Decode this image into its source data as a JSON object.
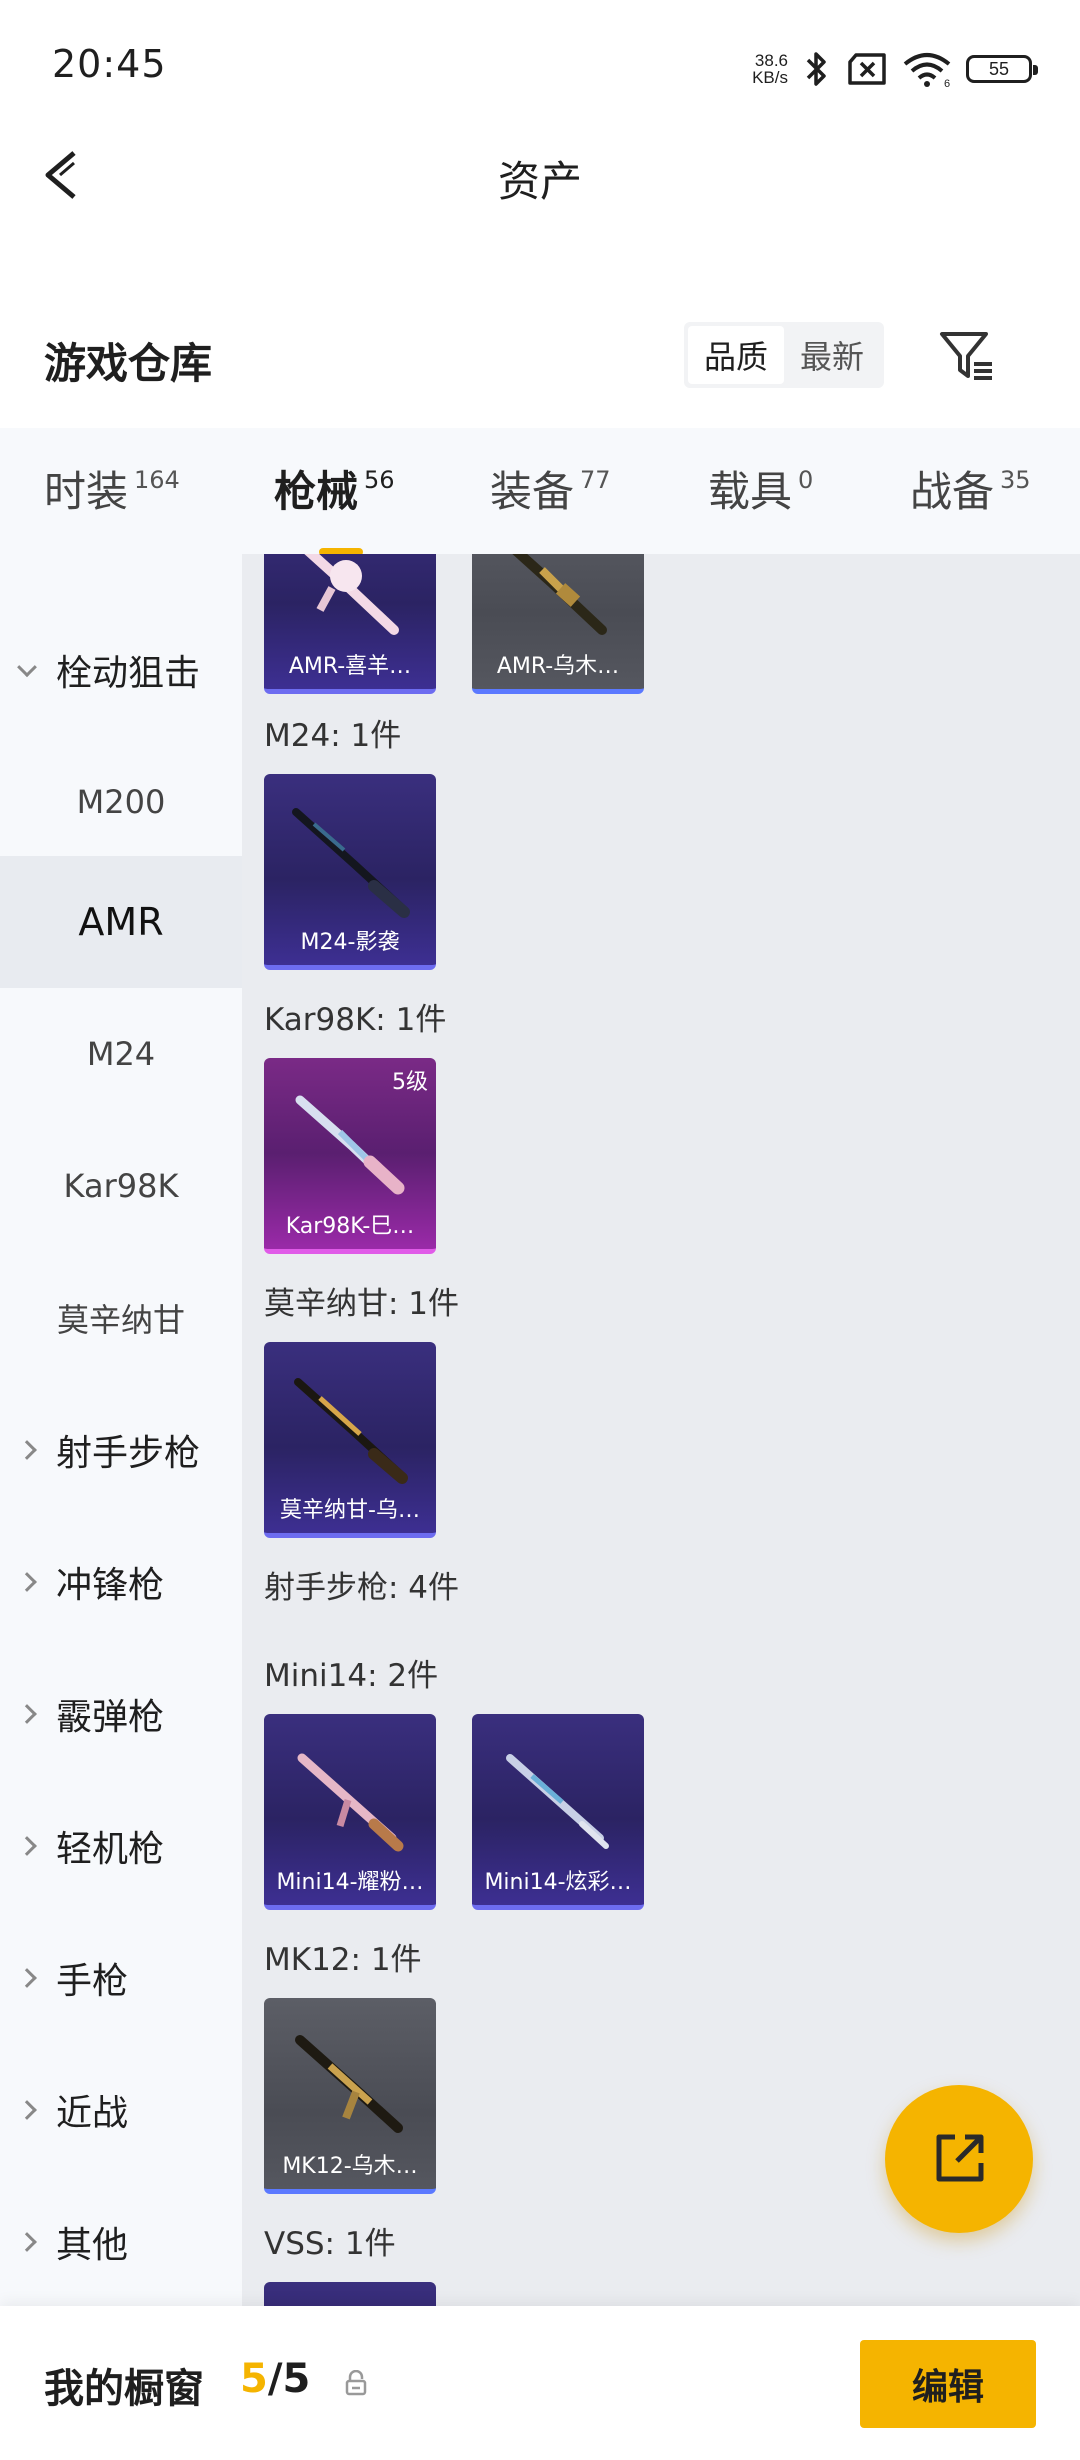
{
  "status": {
    "time": "20:45",
    "net_speed_value": "38.6",
    "net_speed_unit": "KB/s",
    "battery": "55",
    "wifi_sub": "6"
  },
  "header": {
    "title": "资产"
  },
  "warehouse": {
    "title": "游戏仓库",
    "sort_options": [
      "品质",
      "最新"
    ],
    "active_sort": "品质"
  },
  "tabs": [
    {
      "label": "时装",
      "count": "164"
    },
    {
      "label": "枪械",
      "count": "56",
      "active": true
    },
    {
      "label": "装备",
      "count": "77"
    },
    {
      "label": "载具",
      "count": "0"
    },
    {
      "label": "战备",
      "count": "35"
    }
  ],
  "side_nav": [
    {
      "label": "栓动狙击",
      "kind": "group",
      "expanded": true
    },
    {
      "label": "M200",
      "kind": "sub"
    },
    {
      "label": "AMR",
      "kind": "sub",
      "selected": true
    },
    {
      "label": "M24",
      "kind": "sub"
    },
    {
      "label": "Kar98K",
      "kind": "sub"
    },
    {
      "label": "莫辛纳甘",
      "kind": "sub"
    },
    {
      "label": "射手步枪",
      "kind": "group"
    },
    {
      "label": "冲锋枪",
      "kind": "group"
    },
    {
      "label": "霰弹枪",
      "kind": "group"
    },
    {
      "label": "轻机枪",
      "kind": "group"
    },
    {
      "label": "手枪",
      "kind": "group"
    },
    {
      "label": "近战",
      "kind": "group"
    },
    {
      "label": "其他",
      "kind": "group"
    }
  ],
  "content": {
    "amr_cards": [
      {
        "name": "AMR-喜羊…",
        "style": "purple"
      },
      {
        "name": "AMR-乌木…",
        "style": "gray"
      }
    ],
    "sections": [
      {
        "label": "M24: 1件",
        "cards": [
          {
            "name": "M24-影袭",
            "style": "purple"
          }
        ]
      },
      {
        "label": "Kar98K: 1件",
        "cards": [
          {
            "name": "Kar98K-巳…",
            "style": "pink",
            "badge": "5级"
          }
        ]
      },
      {
        "label": "莫辛纳甘: 1件",
        "cards": [
          {
            "name": "莫辛纳甘-乌…",
            "style": "purple"
          }
        ]
      },
      {
        "label": "射手步枪: 4件"
      },
      {
        "label": "Mini14: 2件",
        "cards": [
          {
            "name": "Mini14-耀粉…",
            "style": "purple"
          },
          {
            "name": "Mini14-炫彩…",
            "style": "purple"
          }
        ]
      },
      {
        "label": "MK12: 1件",
        "cards": [
          {
            "name": "MK12-乌木…",
            "style": "gray"
          }
        ]
      },
      {
        "label": "VSS: 1件"
      }
    ]
  },
  "bottom_bar": {
    "title": "我的橱窗",
    "count_current": "5",
    "count_sep": "/",
    "count_total": "5",
    "edit_label": "编辑"
  },
  "colors": {
    "accent": "#f5b400",
    "purple_card": "#2b2363",
    "pink_card": "#7a2a86",
    "gray_card": "#4a4c54"
  }
}
